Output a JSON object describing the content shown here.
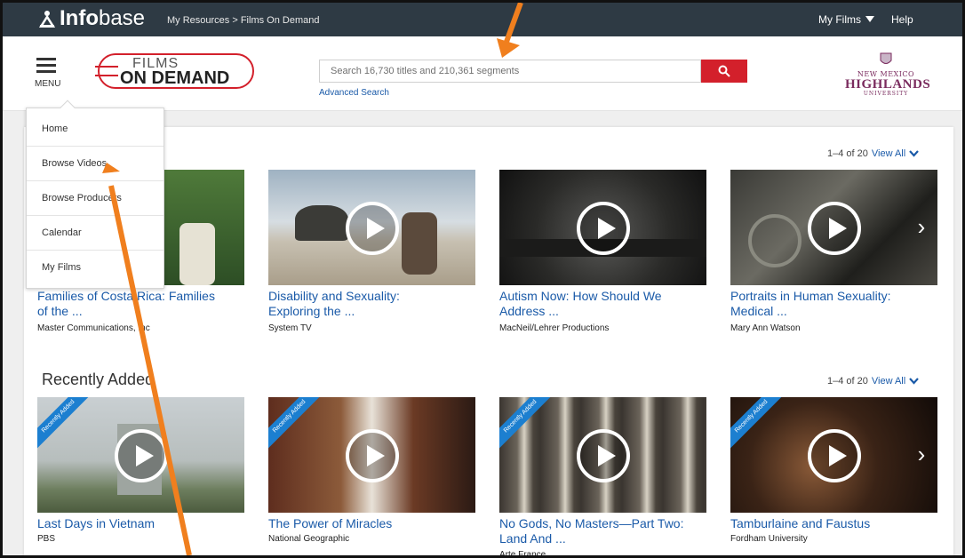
{
  "topbar": {
    "brand_bold": "Info",
    "brand_rest": "base",
    "breadcrumb": "My Resources > Films On Demand",
    "my_films": "My Films",
    "help": "Help"
  },
  "header": {
    "menu_label": "MENU",
    "logo_top": "FILMS",
    "logo_bottom": "ON DEMAND",
    "search_placeholder": "Search 16,730 titles and 210,361 segments",
    "advanced_search": "Advanced Search",
    "university_l1": "NEW MEXICO",
    "university_l2": "HIGHLANDS",
    "university_l3": "UNIVERSITY"
  },
  "menu": {
    "items": [
      "Home",
      "Browse Videos",
      "Browse Producers",
      "Calendar",
      "My Films"
    ]
  },
  "colors": {
    "topbar": "#2e3a44",
    "search_button": "#d3202b",
    "link": "#1a5aa8",
    "ribbon": "#1c7fd0",
    "annotation_arrow": "#f07f1e"
  },
  "section1": {
    "count": "1–4 of 20",
    "view_all": "View All",
    "cards": [
      {
        "title1": "Families of Costa Rica: Families",
        "title2": "of the ...",
        "producer": "Master Communications, Inc"
      },
      {
        "title1": "Disability and Sexuality:",
        "title2": "Exploring the ...",
        "producer": "System TV"
      },
      {
        "title1": "Autism Now: How Should We",
        "title2": "Address ...",
        "producer": "MacNeil/Lehrer Productions"
      },
      {
        "title1": "Portraits in Human Sexuality:",
        "title2": "Medical ...",
        "producer": "Mary Ann Watson"
      }
    ]
  },
  "section2": {
    "heading": "Recently Added",
    "count": "1–4 of 20",
    "view_all": "View All",
    "ribbon": "Recently Added",
    "cards": [
      {
        "title1": "Last Days in Vietnam",
        "title2": "",
        "producer": "PBS"
      },
      {
        "title1": "The Power of Miracles",
        "title2": "",
        "producer": "National Geographic"
      },
      {
        "title1": "No Gods, No Masters—Part Two:",
        "title2": "Land And ...",
        "producer": "Arte France"
      },
      {
        "title1": "Tamburlaine and Faustus",
        "title2": "",
        "producer": "Fordham University"
      }
    ]
  }
}
